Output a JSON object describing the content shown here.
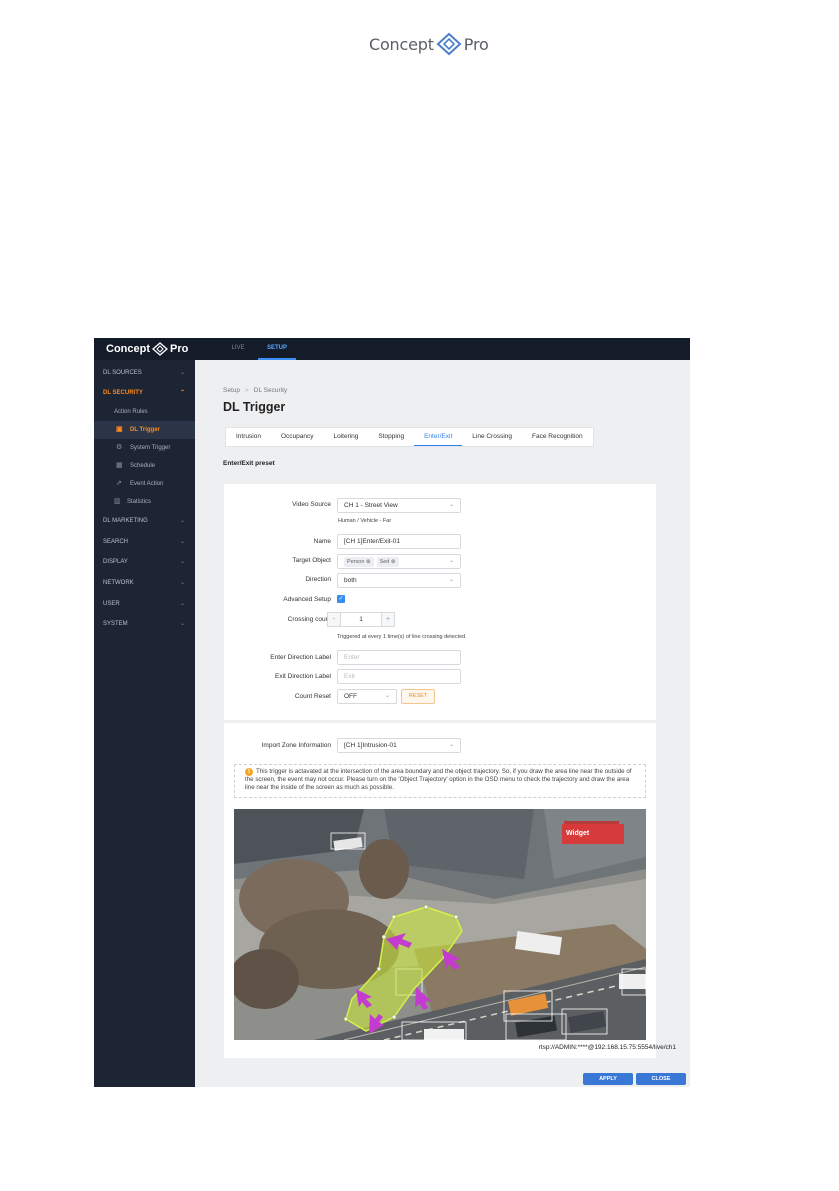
{
  "page_logo": {
    "brand": "Concept",
    "suffix": "Pro"
  },
  "app": {
    "logo": {
      "brand": "Concept",
      "suffix": "Pro"
    },
    "top_tabs": [
      "LIVE",
      "SETUP"
    ]
  },
  "sidebar": {
    "sections": [
      "DL SOURCES",
      "DL SECURITY",
      "DL MARKETING",
      "SEARCH",
      "DISPLAY",
      "NETWORK",
      "USER",
      "SYSTEM"
    ],
    "action_rules": "Action Rules",
    "sub_items": [
      "DL Trigger",
      "System Trigger",
      "Schedule",
      "Event Action"
    ],
    "statistics": "Statistics"
  },
  "breadcrumb": [
    "Setup",
    "DL Security"
  ],
  "page_title": "DL Trigger",
  "tabs": [
    "Intrusion",
    "Occupancy",
    "Loitering",
    "Stopping",
    "Enter/Exit",
    "Line Crossing",
    "Face Recognition"
  ],
  "preset_title": "Enter/Exit preset",
  "form": {
    "video_source_label": "Video Source",
    "video_source_value": "CH 1 - Street View",
    "video_source_hint": "Human / Vehicle - Far",
    "name_label": "Name",
    "name_value": "[CH 1]Enter/Exit-01",
    "target_label": "Target Object",
    "target_chips": [
      "Person ⊗",
      "Sed ⊗"
    ],
    "direction_label": "Direction",
    "direction_value": "both",
    "advanced_label": "Advanced Setup",
    "crossing_label": "Crossing count",
    "crossing_minus": "-",
    "crossing_value": "1",
    "crossing_plus": "+",
    "crossing_hint": "Triggered at every 1 time(s) of line crossing detected.",
    "enter_label": "Enter Direction Label",
    "enter_placeholder": "Enter",
    "exit_label": "Exit Direction Label",
    "exit_placeholder": "Exit",
    "count_reset_label": "Count Reset",
    "count_reset_value": "OFF",
    "reset_button": "RESET"
  },
  "zone": {
    "import_label": "Import Zone Information",
    "import_value": "[CH 1]Intrusion-01",
    "notice": "This trigger is actavated at the intersection of the area boundary and the object trajectory. So, if you draw the area line near the outside of the screen, the event may not occur. Please turn on the 'Object Trajectory' option in the OSD menu to check the trajectory and draw the area line near the inside of the screen as much as possible.",
    "widget": "Widget",
    "rtsp": "rtsp://ADMIN:****@192.168.15.75:5554/live/ch1"
  },
  "buttons": {
    "apply": "APPLY",
    "close": "CLOSE"
  },
  "colors": {
    "accent": "#ff8a1c",
    "primary": "#3a78d6",
    "zone_fill": "#c8e63c",
    "arrows": "#c43bd0"
  }
}
